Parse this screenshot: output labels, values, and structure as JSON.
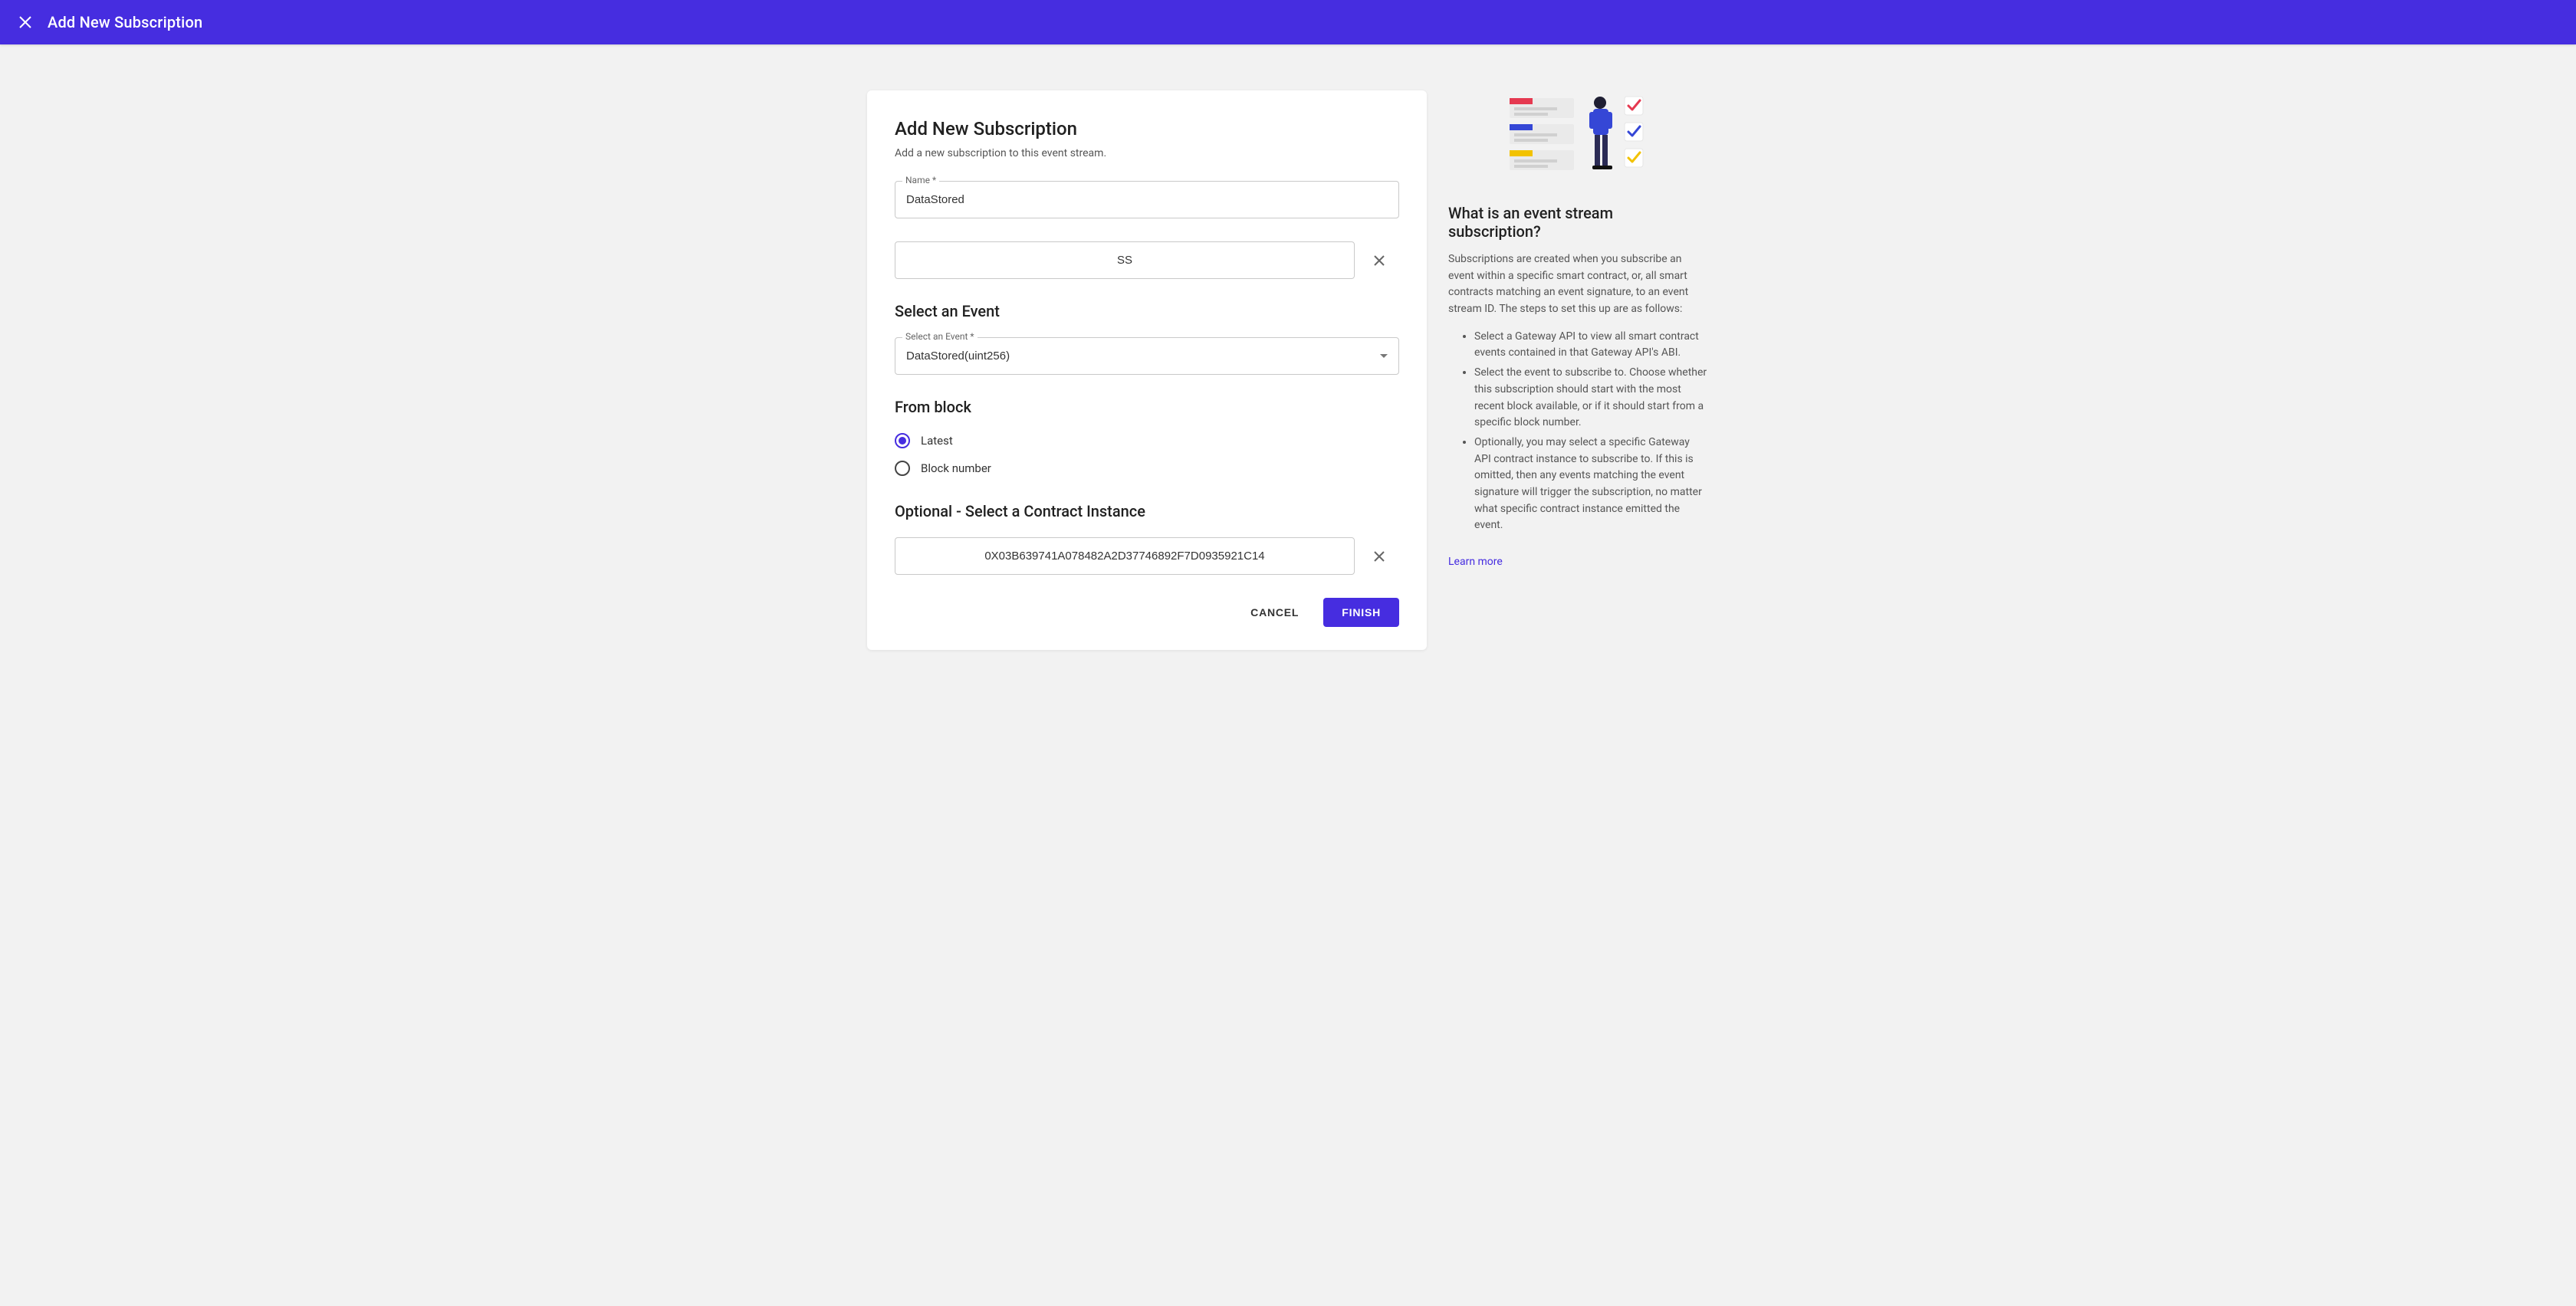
{
  "topbar": {
    "title": "Add New Subscription"
  },
  "form": {
    "heading": "Add New Subscription",
    "subtitle": "Add a new subscription to this event stream.",
    "name_label": "Name *",
    "name_value": "DataStored",
    "filter_value": "SS",
    "select_event_heading": "Select an Event",
    "select_event_label": "Select an Event *",
    "select_event_value": "DataStored(uint256)",
    "from_block_heading": "From block",
    "radio_latest": "Latest",
    "radio_block_number": "Block number",
    "contract_heading": "Optional - Select a Contract Instance",
    "contract_value": "0X03B639741A078482A2D37746892F7D0935921C14",
    "cancel_label": "CANCEL",
    "finish_label": "FINISH"
  },
  "info": {
    "heading": "What is an event stream subscription?",
    "paragraph": "Subscriptions are created when you subscribe an event within a specific smart contract, or, all smart contracts matching an event signature, to an event stream ID. The steps to set this up are as follows:",
    "bullets": [
      "Select a Gateway API to view all smart contract events contained in that Gateway API's ABI.",
      "Select the event to subscribe to. Choose whether this subscription should start with the most recent block available, or if it should start from a specific block number.",
      "Optionally, you may select a specific Gateway API contract instance to subscribe to. If this is omitted, then any events matching the event signature will trigger the subscription, no matter what specific contract instance emitted the event."
    ],
    "learn_more": "Learn more"
  }
}
